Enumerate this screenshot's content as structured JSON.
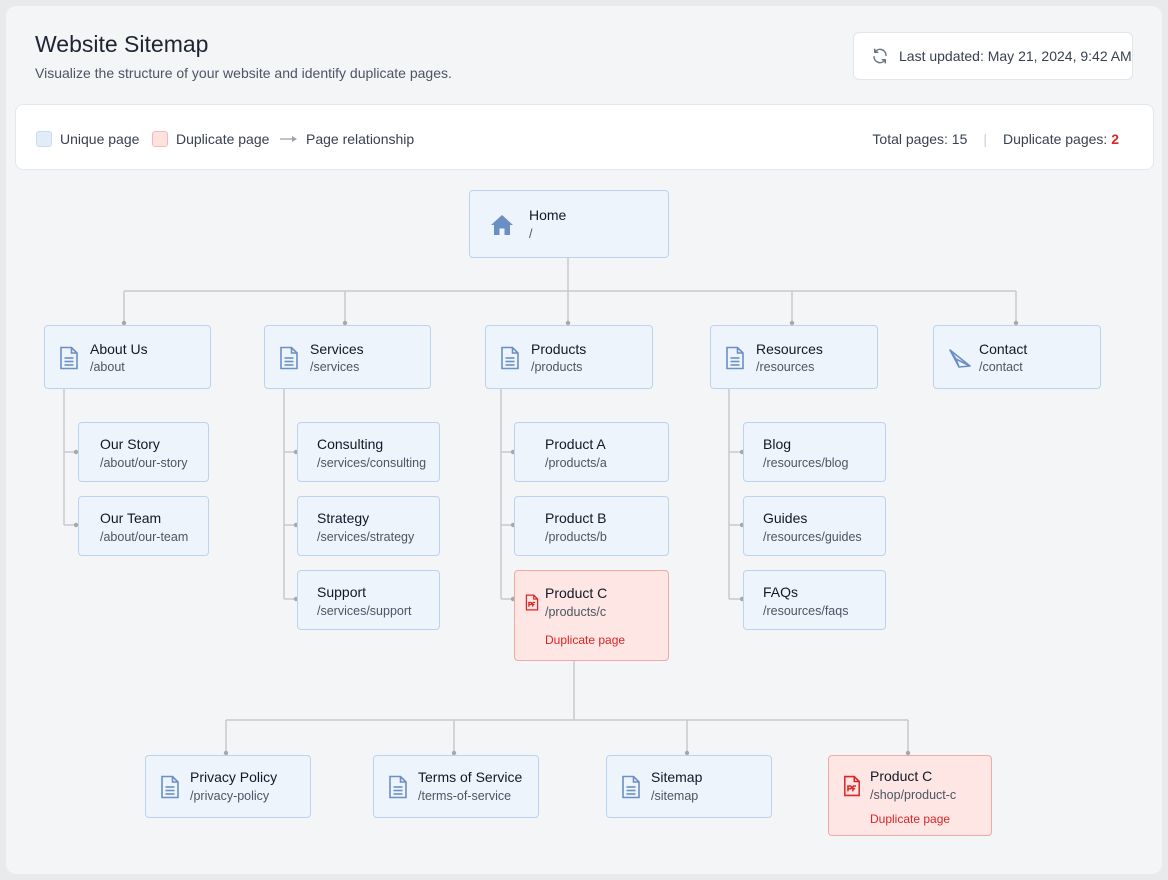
{
  "header": {
    "title": "Website Sitemap",
    "subtitle": "Visualize the structure of your website and identify duplicate pages.",
    "last_updated": "Last updated: May 21, 2024, 9:42 AM",
    "refresh_icon": "refresh-icon"
  },
  "legend": {
    "unique": "Unique page",
    "duplicate": "Duplicate page",
    "relationship": "Page relationship",
    "total_label": "Total pages: 15",
    "duplicate_label": "Duplicate pages:",
    "duplicate_count": "2"
  },
  "colors": {
    "unique_fill": "#eef4fc",
    "unique_border": "#bcd3ef",
    "duplicate_fill": "#fde6e4",
    "duplicate_border": "#f0aaa4",
    "duplicate_text": "#dc2626",
    "icon_blue": "#6b8fc4",
    "connector": "#c7c9ce"
  },
  "duplicate_tag": "Duplicate page",
  "nodes": {
    "home": {
      "name": "Home",
      "path": "/",
      "icon": "home-icon"
    },
    "about": {
      "name": "About Us",
      "path": "/about",
      "icon": "document-icon"
    },
    "services": {
      "name": "Services",
      "path": "/services",
      "icon": "document-icon"
    },
    "products": {
      "name": "Products",
      "path": "/products",
      "icon": "document-icon"
    },
    "resources": {
      "name": "Resources",
      "path": "/resources",
      "icon": "document-icon"
    },
    "contact": {
      "name": "Contact",
      "path": "/contact",
      "icon": "send-icon"
    },
    "our_story": {
      "name": "Our Story",
      "path": "/about/our-story"
    },
    "our_team": {
      "name": "Our Team",
      "path": "/about/our-team"
    },
    "consulting": {
      "name": "Consulting",
      "path": "/services/consulting"
    },
    "strategy": {
      "name": "Strategy",
      "path": "/services/strategy"
    },
    "support": {
      "name": "Support",
      "path": "/services/support"
    },
    "product_a": {
      "name": "Product A",
      "path": "/products/a"
    },
    "product_b": {
      "name": "Product B",
      "path": "/products/b"
    },
    "product_c": {
      "name": "Product C",
      "path": "/products/c",
      "icon": "pdf-document-icon",
      "duplicate": true
    },
    "blog": {
      "name": "Blog",
      "path": "/resources/blog"
    },
    "guides": {
      "name": "Guides",
      "path": "/resources/guides"
    },
    "faqs": {
      "name": "FAQs",
      "path": "/resources/faqs"
    },
    "privacy": {
      "name": "Privacy Policy",
      "path": "/privacy-policy",
      "icon": "document-icon"
    },
    "terms": {
      "name": "Terms of Service",
      "path": "/terms-of-service",
      "icon": "document-icon"
    },
    "sitemap": {
      "name": "Sitemap",
      "path": "/sitemap",
      "icon": "document-icon"
    },
    "shop_product_c": {
      "name": "Product C",
      "path": "/shop/product-c",
      "icon": "pdf-document-icon",
      "duplicate": true
    }
  }
}
